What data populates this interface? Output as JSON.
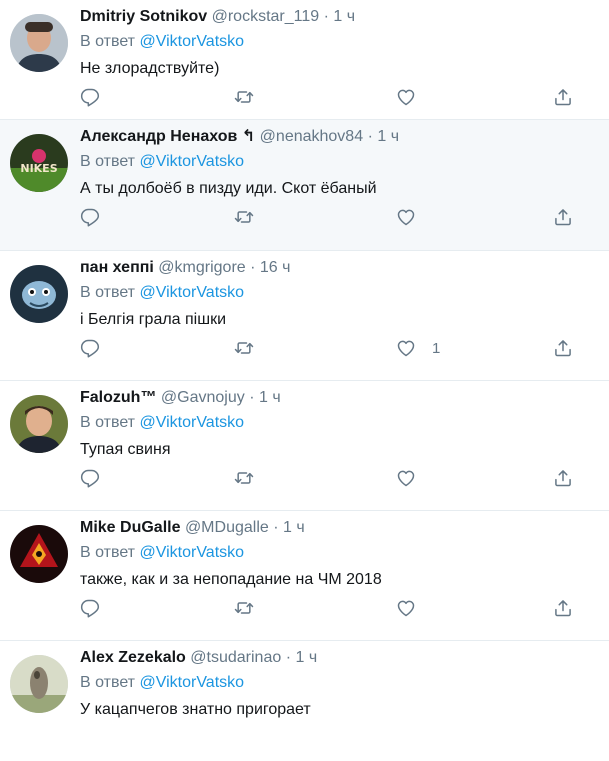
{
  "reply_prefix": "В ответ",
  "tweets": [
    {
      "name": "Dmitriy Sotnikov",
      "handle": "@rockstar_119",
      "sep": "·",
      "time": "1 ч",
      "mention": "@ViktorVatsko",
      "text": "Не злорадствуйте)",
      "likes": ""
    },
    {
      "name": "Александр Ненахов ↰",
      "handle": "@nenakhov84",
      "sep": "·",
      "time": "1 ч",
      "mention": "@ViktorVatsko",
      "text": "А ты долбоёб в пизду иди. Скот ёбаный",
      "likes": ""
    },
    {
      "name": "пан хеппі",
      "handle": "@kmgrigore",
      "sep": "·",
      "time": "16 ч",
      "mention": "@ViktorVatsko",
      "text": "і Белгія грала пішки",
      "likes": "1"
    },
    {
      "name": "Falozuh™",
      "handle": "@Gavnojuy",
      "sep": "·",
      "time": "1 ч",
      "mention": "@ViktorVatsko",
      "text": "Тупая свиня",
      "likes": ""
    },
    {
      "name": "Mike DuGalle",
      "handle": "@MDugalle",
      "sep": "·",
      "time": "1 ч",
      "mention": "@ViktorVatsko",
      "text": "также, как и за непопадание на ЧМ 2018",
      "likes": ""
    },
    {
      "name": "Alex Zezekalo",
      "handle": "@tsudarinao",
      "sep": "·",
      "time": "1 ч",
      "mention": "@ViktorVatsko",
      "text": "У кацапчегов знатно пригорает",
      "likes": ""
    }
  ],
  "colors": {
    "link": "#1b95e0",
    "secondary": "#657786",
    "border": "#e6ecf0",
    "highlight_bg": "#f5f8fa"
  },
  "icons": [
    "reply-icon",
    "retweet-icon",
    "like-icon",
    "share-icon"
  ]
}
